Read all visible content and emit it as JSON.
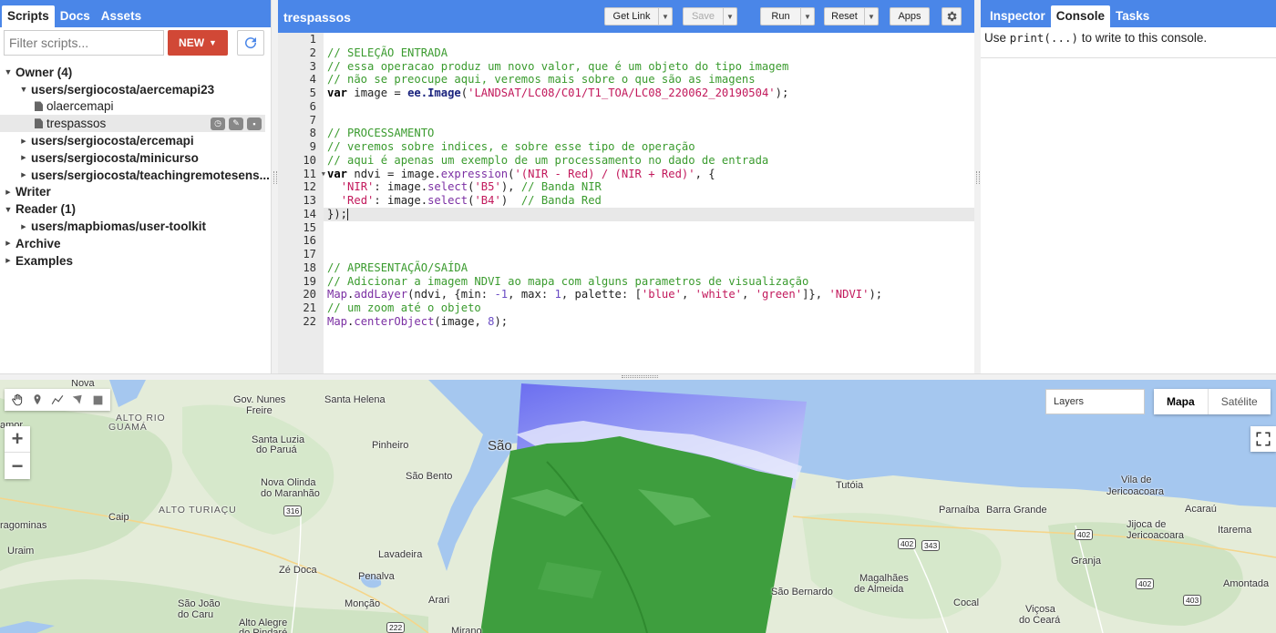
{
  "left_panel": {
    "tabs": [
      {
        "label": "Scripts",
        "active": true
      },
      {
        "label": "Docs",
        "active": false
      },
      {
        "label": "Assets",
        "active": false
      }
    ],
    "filter_placeholder": "Filter scripts...",
    "new_button": "NEW",
    "tree": [
      {
        "label": "Owner (4)",
        "indent": 0,
        "expander": "down",
        "bold": true
      },
      {
        "label": "users/sergiocosta/aercemapi23",
        "indent": 1,
        "expander": "down",
        "bold": true
      },
      {
        "label": "olaercemapi",
        "indent": 2,
        "expander": "file",
        "bold": false
      },
      {
        "label": "trespassos",
        "indent": 2,
        "expander": "file",
        "bold": false,
        "selected": true
      },
      {
        "label": "users/sergiocosta/ercemapi",
        "indent": 1,
        "expander": "right",
        "bold": true
      },
      {
        "label": "users/sergiocosta/minicurso",
        "indent": 1,
        "expander": "right",
        "bold": true
      },
      {
        "label": "users/sergiocosta/teachingremotesens...",
        "indent": 1,
        "expander": "right",
        "bold": true
      },
      {
        "label": "Writer",
        "indent": 0,
        "expander": "right",
        "bold": true
      },
      {
        "label": "Reader (1)",
        "indent": 0,
        "expander": "down",
        "bold": true
      },
      {
        "label": "users/mapbiomas/user-toolkit",
        "indent": 1,
        "expander": "right",
        "bold": true
      },
      {
        "label": "Archive",
        "indent": 0,
        "expander": "right",
        "bold": true
      },
      {
        "label": "Examples",
        "indent": 0,
        "expander": "right",
        "bold": true
      }
    ]
  },
  "editor": {
    "title": "trespassos",
    "buttons": {
      "get_link": "Get Link",
      "save": "Save",
      "run": "Run",
      "reset": "Reset",
      "apps": "Apps"
    },
    "active_line": 14,
    "code_lines": [
      "",
      "// SELEÇÃO ENTRADA",
      "// essa operacao produz um novo valor, que é um objeto do tipo imagem",
      "// não se preocupe aqui, veremos mais sobre o que são as imagens",
      "var image = ee.Image('LANDSAT/LC08/C01/T1_TOA/LC08_220062_20190504');",
      "",
      "",
      "// PROCESSAMENTO",
      "// veremos sobre indices, e sobre esse tipo de operação",
      "// aqui é apenas um exemplo de um processamento no dado de entrada",
      "var ndvi = image.expression('(NIR - Red) / (NIR + Red)', {",
      "  'NIR': image.select('B5'), // Banda NIR",
      "  'Red': image.select('B4')  // Banda Red",
      "});",
      "",
      "",
      "",
      "// APRESENTAÇÃO/SAÍDA",
      "// Adicionar a imagem NDVI ao mapa com alguns parametros de visualização",
      "Map.addLayer(ndvi, {min: -1, max: 1, palette: ['blue', 'white', 'green']}, 'NDVI');",
      "// um zoom até o objeto",
      "Map.centerObject(image, 8);"
    ]
  },
  "right_panel": {
    "tabs": [
      {
        "label": "Inspector",
        "active": false
      },
      {
        "label": "Console",
        "active": true
      },
      {
        "label": "Tasks",
        "active": false
      }
    ],
    "console_pre": "Use ",
    "console_code": "print(...)",
    "console_post": " to write to this console."
  },
  "map": {
    "layers_label": "Layers",
    "map_types": [
      {
        "label": "Mapa",
        "active": true
      },
      {
        "label": "Satélite",
        "active": false
      }
    ],
    "places": [
      {
        "label": "Nova"
      },
      {
        "label": "Gov. Nunes"
      },
      {
        "label": "Freire"
      },
      {
        "label": "Santa Helena"
      },
      {
        "label": "ALTO RIO"
      },
      {
        "label": "GUAMÁ"
      },
      {
        "label": "amor"
      },
      {
        "label": "Santa Luzia"
      },
      {
        "label": "do Paruá"
      },
      {
        "label": "Pinheiro"
      },
      {
        "label": "São Bento"
      },
      {
        "label": "Nova Olinda"
      },
      {
        "label": "do Maranhão"
      },
      {
        "label": "ALTO TURIAÇU"
      },
      {
        "label": "Caip"
      },
      {
        "label": "ragominas"
      },
      {
        "label": "Uraim"
      },
      {
        "label": "Lavadeira"
      },
      {
        "label": "Zé Doca"
      },
      {
        "label": "Penalva"
      },
      {
        "label": "Arari"
      },
      {
        "label": "São João"
      },
      {
        "label": "do Caru"
      },
      {
        "label": "Monção"
      },
      {
        "label": "Alto Alegre"
      },
      {
        "label": "do Pindaré"
      },
      {
        "label": "Mirano"
      },
      {
        "label": "São"
      },
      {
        "label": "Tutóia"
      },
      {
        "label": "Vila de"
      },
      {
        "label": "Jericoacoara"
      },
      {
        "label": "Parnaíba"
      },
      {
        "label": "Barra Grande"
      },
      {
        "label": "Acaraú"
      },
      {
        "label": "Jijoca de"
      },
      {
        "label": "Jericoacoara"
      },
      {
        "label": "Itarema"
      },
      {
        "label": "Granja"
      },
      {
        "label": "São Bernardo"
      },
      {
        "label": "Magalhães"
      },
      {
        "label": "de Almeida"
      },
      {
        "label": "Cocal"
      },
      {
        "label": "Viçosa"
      },
      {
        "label": "do Ceará"
      },
      {
        "label": "Amontada"
      }
    ],
    "shields": [
      "316",
      "222",
      "402",
      "343",
      "402",
      "402",
      "403"
    ]
  },
  "colors": {
    "header_blue": "#4a86e8",
    "new_button_red": "#d14836",
    "comment_green": "#3a9b2e",
    "string_pink": "#c2185b",
    "number_purple": "#6a4cc4",
    "ndvi_green": "#3e9e3e",
    "water_blue": "#a5c7ef",
    "land": "#e4ecd9"
  }
}
